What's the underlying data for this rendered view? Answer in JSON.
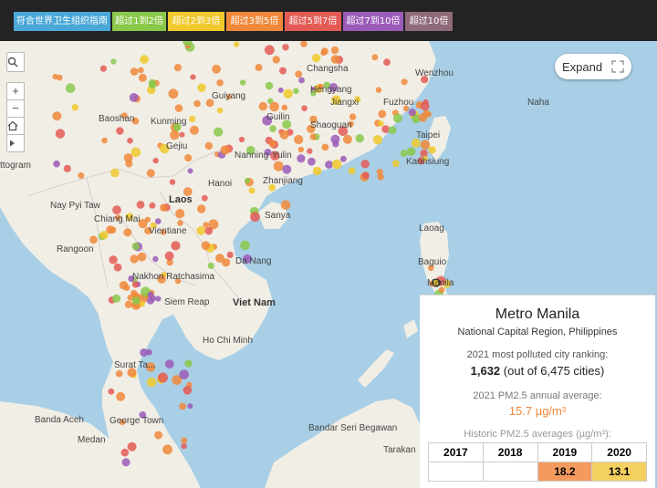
{
  "legend": {
    "items": [
      {
        "label": "符合世界卫生组织指南",
        "color": "#4aa8d8"
      },
      {
        "label": "超过1到2倍",
        "color": "#8ac84a"
      },
      {
        "label": "超过2到3倍",
        "color": "#f0c92c"
      },
      {
        "label": "超过3到5倍",
        "color": "#f0883a"
      },
      {
        "label": "超过5到7倍",
        "color": "#e45a55"
      },
      {
        "label": "超过7到10倍",
        "color": "#9b5bb8"
      },
      {
        "label": "超过10倍",
        "color": "#8f6a7a"
      }
    ]
  },
  "controls": {
    "search_icon": "magnifier-icon",
    "zoom_in": "+",
    "zoom_out": "−",
    "home_icon": "home-icon",
    "play_icon": "play-icon"
  },
  "expand": {
    "label": "Expand",
    "icon": "fullscreen-icon"
  },
  "map": {
    "land_color": "#f1eee6",
    "water_color": "#a8cfe6",
    "labels": {
      "laos": "Laos",
      "vietnam": "Viet Nam",
      "baoshan": "Baoshan",
      "kunming": "Kunming",
      "guiyang": "Guiyang",
      "changsha": "Changsha",
      "hengyang": "Hengyang",
      "guilin": "Guilin",
      "shaoguan": "Shaoguan",
      "gejiu": "Gejiu",
      "nanning": "Nanning",
      "yulin": "Yulin",
      "hanoi": "Hanoi",
      "zhanjiang": "Zhanjiang",
      "sanya": "Sanya",
      "nay_pyi_taw": "Nay Pyi Taw",
      "chiang_mai": "Chiang Mai",
      "vientiane": "Vientiane",
      "rangoon": "Rangoon",
      "nakhon": "Nakhon Ratchasima",
      "siem_reap": "Siem Reap",
      "da_nang": "Da Nang",
      "ho_chi_minh": "Ho Chi Minh",
      "surat": "Surat Ta...",
      "banda_aceh": "Banda Aceh",
      "medan": "Medan",
      "george_town": "George Town",
      "bandar": "Bandar Seri Begawan",
      "tarakan": "Tarakan",
      "laoag": "Laoag",
      "baguio": "Baguio",
      "manila": "Manila",
      "kaohsiung": "Kaohsiung",
      "taipei": "Taipei",
      "naha": "Naha",
      "wenzhou": "Wenzhou",
      "fuzhou": "Fuzhou",
      "ttogram": "ttogram",
      "jiangxi": "Jiangxi"
    }
  },
  "info": {
    "city": "Metro Manila",
    "region": "National Capital Region, Philippines",
    "ranking_label": "2021 most polluted city ranking:",
    "ranking_value": "1,632",
    "ranking_suffix": "(out of 6,475 cities)",
    "avg_label": "2021 PM2.5 annual average:",
    "avg_value": "15.7 µg/m³",
    "hist_label": "Historic PM2.5 averages (µg/m³):",
    "years": [
      "2017",
      "2018",
      "2019",
      "2020"
    ],
    "values": [
      "",
      "",
      "18.2",
      "13.1"
    ],
    "value_colors": [
      "#ffffff",
      "#ffffff",
      "#f49a5e",
      "#f4d060"
    ]
  }
}
